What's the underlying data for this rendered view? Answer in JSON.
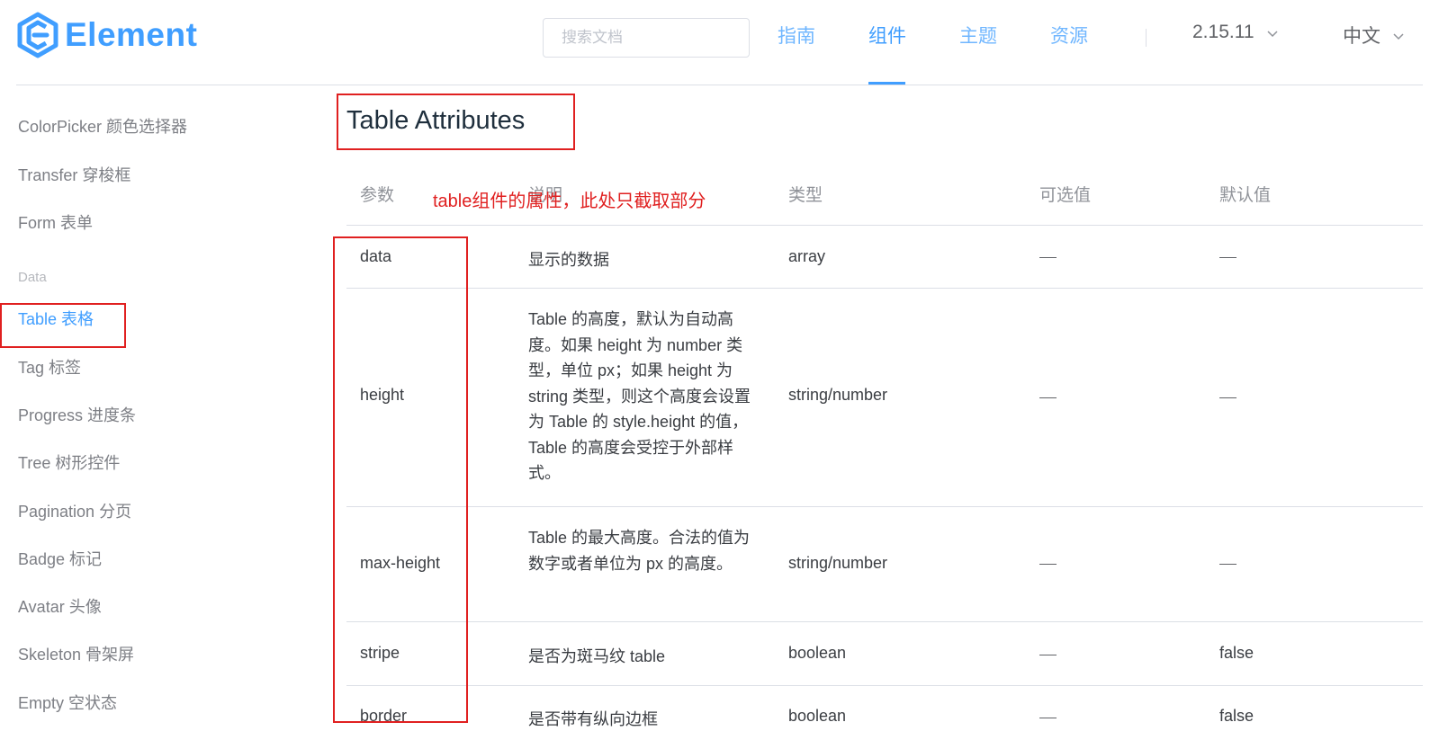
{
  "header": {
    "brand": "Element",
    "search_placeholder": "搜索文档",
    "nav": [
      "指南",
      "组件",
      "主题",
      "资源"
    ],
    "active_nav": "组件",
    "version": "2.15.11",
    "language": "中文",
    "accent_color": "#409eff"
  },
  "sidebar": {
    "items_before": [
      "ColorPicker 颜色选择器",
      "Transfer 穿梭框",
      "Form 表单"
    ],
    "group_label": "Data",
    "active_item": "Table 表格",
    "items_after": [
      "Tag 标签",
      "Progress 进度条",
      "Tree 树形控件",
      "Pagination 分页",
      "Badge 标记",
      "Avatar 头像",
      "Skeleton 骨架屏",
      "Empty 空状态"
    ]
  },
  "main": {
    "section_title": "Table Attributes",
    "annotation": "table组件的属性，此处只截取部分",
    "columns": [
      "参数",
      "说明",
      "类型",
      "可选值",
      "默认值"
    ],
    "rows": [
      {
        "param": "data",
        "desc": "显示的数据",
        "type": "array",
        "options": "—",
        "default": "—"
      },
      {
        "param": "height",
        "desc": "Table 的高度，默认为自动高度。如果 height 为 number 类型，单位 px；如果 height 为 string 类型，则这个高度会设置为 Table 的 style.height 的值，Table 的高度会受控于外部样式。",
        "type": "string/number",
        "options": "—",
        "default": "—"
      },
      {
        "param": "max-height",
        "desc": "Table 的最大高度。合法的值为数字或者单位为 px 的高度。",
        "type": "string/number",
        "options": "—",
        "default": "—"
      },
      {
        "param": "stripe",
        "desc": "是否为斑马纹 table",
        "type": "boolean",
        "options": "—",
        "default": "false"
      },
      {
        "param": "border",
        "desc": "是否带有纵向边框",
        "type": "boolean",
        "options": "—",
        "default": "false"
      }
    ],
    "annotation_color": "#e02020"
  }
}
